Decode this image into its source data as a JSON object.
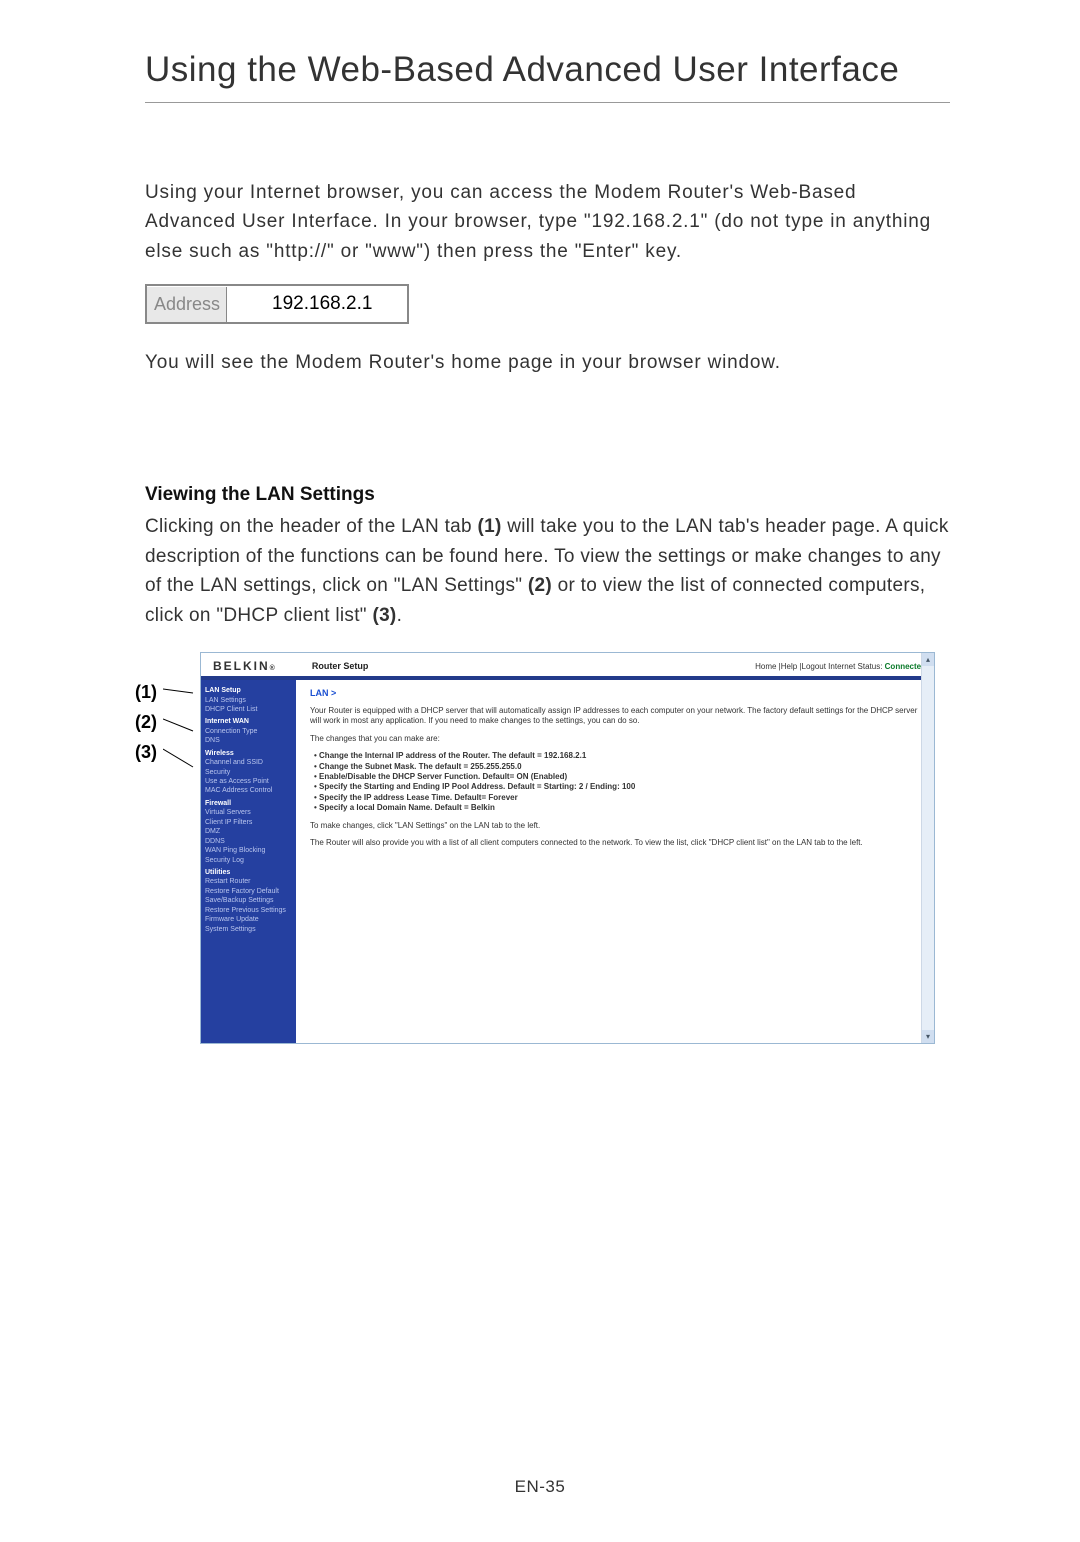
{
  "page_title": "Using the Web-Based Advanced User Interface",
  "intro": "Using your Internet browser, you can access the Modem Router's Web-Based Advanced User Interface. In your browser, type \"192.168.2.1\" (do not type in anything else such as \"http://\" or \"www\") then press the \"Enter\" key.",
  "address_bar": {
    "label": "Address",
    "value": "192.168.2.1"
  },
  "followup": "You will see the Modem Router's home page in your browser window.",
  "section": {
    "heading": "Viewing the LAN Settings",
    "body_pre": "Clicking on the header of the LAN tab ",
    "ref1": "(1)",
    "body_mid1": " will take you to the LAN tab's header page. A quick description of the functions can be found here. To view the settings or make changes to any of the LAN settings, click on \"LAN Settings\" ",
    "ref2": "(2)",
    "body_mid2": " or to view the list of connected computers, click on \"DHCP client list\" ",
    "ref3": "(3)",
    "body_end": "."
  },
  "callouts": [
    "(1)",
    "(2)",
    "(3)"
  ],
  "router": {
    "logo": "BELKIN",
    "logo_suffix": "®",
    "title": "Router Setup",
    "header_links": "Home |Help |Logout   Internet Status: ",
    "status": "Connected",
    "breadcrumb": "LAN >",
    "para1": "Your Router is equipped with a DHCP server that will automatically assign IP addresses to each computer on your network. The factory default settings for the DHCP server will work in most any application. If you need to make changes to the settings, you can do so.",
    "para2": "The changes that you can make are:",
    "bullets": [
      "Change the Internal IP address of the Router. The default = 192.168.2.1",
      "Change the Subnet Mask. The default = 255.255.255.0",
      "Enable/Disable the DHCP Server Function. Default= ON (Enabled)",
      "Specify the Starting and Ending IP Pool Address. Default = Starting: 2 / Ending: 100",
      "Specify the IP address Lease Time. Default= Forever",
      "Specify a local Domain Name. Default = Belkin"
    ],
    "para3": "To make changes, click \"LAN Settings\" on the LAN tab to the left.",
    "para4": "The Router will also provide you with a list of all client computers connected to the network. To view the list, click \"DHCP client list\" on the LAN tab to the left.",
    "sidebar": [
      {
        "t": "head",
        "v": "LAN Setup"
      },
      {
        "t": "item",
        "v": "LAN Settings"
      },
      {
        "t": "item",
        "v": "DHCP Client List"
      },
      {
        "t": "head",
        "v": "Internet WAN"
      },
      {
        "t": "item",
        "v": "Connection Type"
      },
      {
        "t": "item",
        "v": "DNS"
      },
      {
        "t": "head",
        "v": "Wireless"
      },
      {
        "t": "item",
        "v": "Channel and SSID"
      },
      {
        "t": "item",
        "v": "Security"
      },
      {
        "t": "item",
        "v": "Use as Access Point"
      },
      {
        "t": "item",
        "v": "MAC Address Control"
      },
      {
        "t": "head",
        "v": "Firewall"
      },
      {
        "t": "item",
        "v": "Virtual Servers"
      },
      {
        "t": "item",
        "v": "Client IP Filters"
      },
      {
        "t": "item",
        "v": "DMZ"
      },
      {
        "t": "item",
        "v": "DDNS"
      },
      {
        "t": "item",
        "v": "WAN Ping Blocking"
      },
      {
        "t": "item",
        "v": "Security Log"
      },
      {
        "t": "head",
        "v": "Utilities"
      },
      {
        "t": "item",
        "v": "Restart Router"
      },
      {
        "t": "item",
        "v": "Restore Factory Default"
      },
      {
        "t": "item",
        "v": "Save/Backup Settings"
      },
      {
        "t": "item",
        "v": "Restore Previous Settings"
      },
      {
        "t": "item",
        "v": "Firmware Update"
      },
      {
        "t": "item",
        "v": "System Settings"
      }
    ]
  },
  "footer": "EN-35"
}
